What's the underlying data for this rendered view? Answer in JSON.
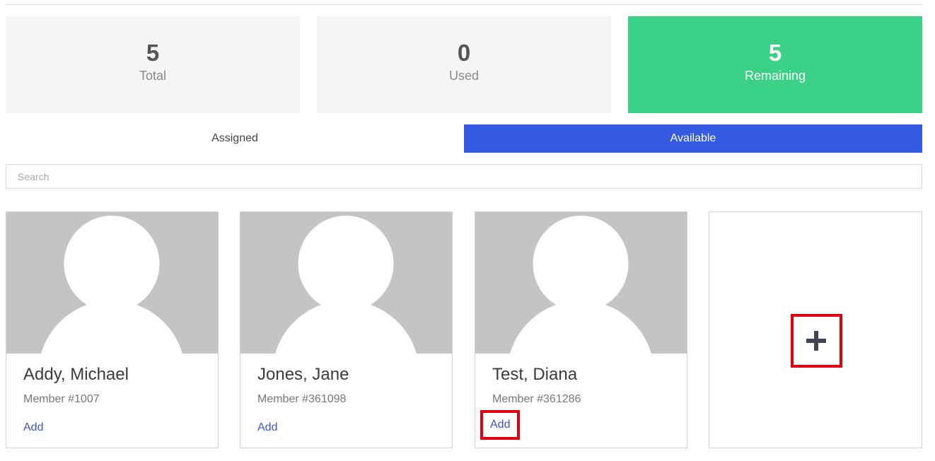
{
  "stats": {
    "total": {
      "value": "5",
      "label": "Total"
    },
    "used": {
      "value": "0",
      "label": "Used"
    },
    "remaining": {
      "value": "5",
      "label": "Remaining"
    }
  },
  "tabs": {
    "assigned": "Assigned",
    "available": "Available",
    "active": "Available"
  },
  "search": {
    "placeholder": "Search",
    "value": ""
  },
  "members": [
    {
      "name": "Addy, Michael",
      "number": "Member #1007",
      "action": "Add"
    },
    {
      "name": "Jones, Jane",
      "number": "Member #361098",
      "action": "Add"
    },
    {
      "name": "Test, Diana",
      "number": "Member #361286",
      "action": "Add"
    }
  ],
  "add_card": {
    "icon": "plus-icon"
  },
  "colors": {
    "remaining_bg": "#3ad086",
    "active_tab_bg": "#355ae4",
    "link": "#3a55d4",
    "highlight_outline": "#e0000f",
    "avatar_bg": "#c4c4c4"
  }
}
